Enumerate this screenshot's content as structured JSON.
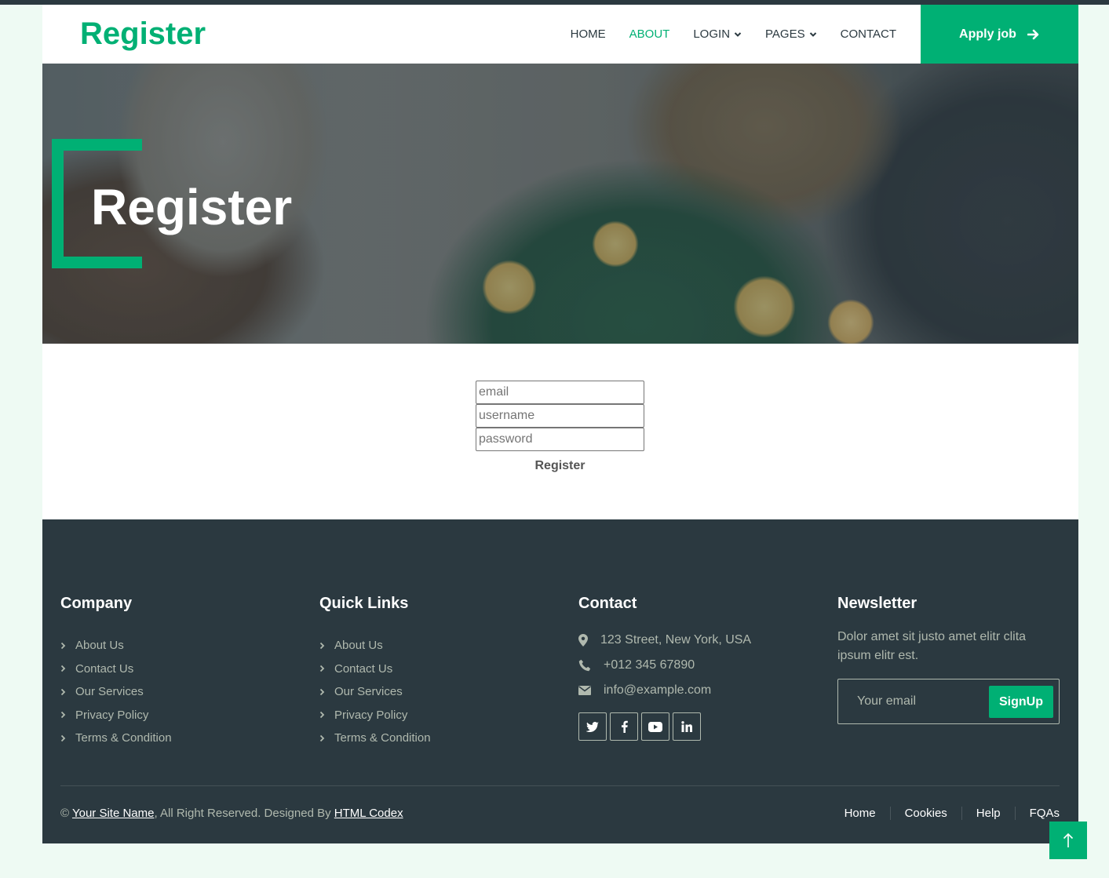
{
  "brand": "Register",
  "nav": {
    "items": [
      {
        "label": "HOME",
        "active": false,
        "dropdown": false
      },
      {
        "label": "ABOUT",
        "active": true,
        "dropdown": false
      },
      {
        "label": "LOGIN",
        "active": false,
        "dropdown": true
      },
      {
        "label": "PAGES",
        "active": false,
        "dropdown": true
      },
      {
        "label": "CONTACT",
        "active": false,
        "dropdown": false
      }
    ],
    "apply_label": "Apply job",
    "apply_icon": "arrow-right-icon"
  },
  "hero": {
    "title": "Register"
  },
  "form": {
    "email_placeholder": "email",
    "username_placeholder": "username",
    "password_placeholder": "password",
    "submit_label": "Register"
  },
  "footer": {
    "company": {
      "heading": "Company",
      "links": [
        "About Us",
        "Contact Us",
        "Our Services",
        "Privacy Policy",
        "Terms & Condition"
      ]
    },
    "quick_links": {
      "heading": "Quick Links",
      "links": [
        "About Us",
        "Contact Us",
        "Our Services",
        "Privacy Policy",
        "Terms & Condition"
      ]
    },
    "contact": {
      "heading": "Contact",
      "address": "123 Street, New York, USA",
      "phone": "+012 345 67890",
      "email": "info@example.com",
      "socials": [
        "twitter-icon",
        "facebook-icon",
        "youtube-icon",
        "linkedin-icon"
      ]
    },
    "newsletter": {
      "heading": "Newsletter",
      "text": "Dolor amet sit justo amet elitr clita ipsum elitr est.",
      "email_placeholder": "Your email",
      "signup_label": "SignUp"
    },
    "copyright": {
      "prefix": "©",
      "site_name": "Your Site Name",
      "middle": ", All Right Reserved. Designed By",
      "designer": "HTML Codex"
    },
    "menu": [
      "Home",
      "Cookies",
      "Help",
      "FQAs"
    ]
  },
  "colors": {
    "accent": "#00b074",
    "dark": "#2b3940",
    "muted_text": "#b0b9ae",
    "page_bg": "#eefaf3"
  }
}
